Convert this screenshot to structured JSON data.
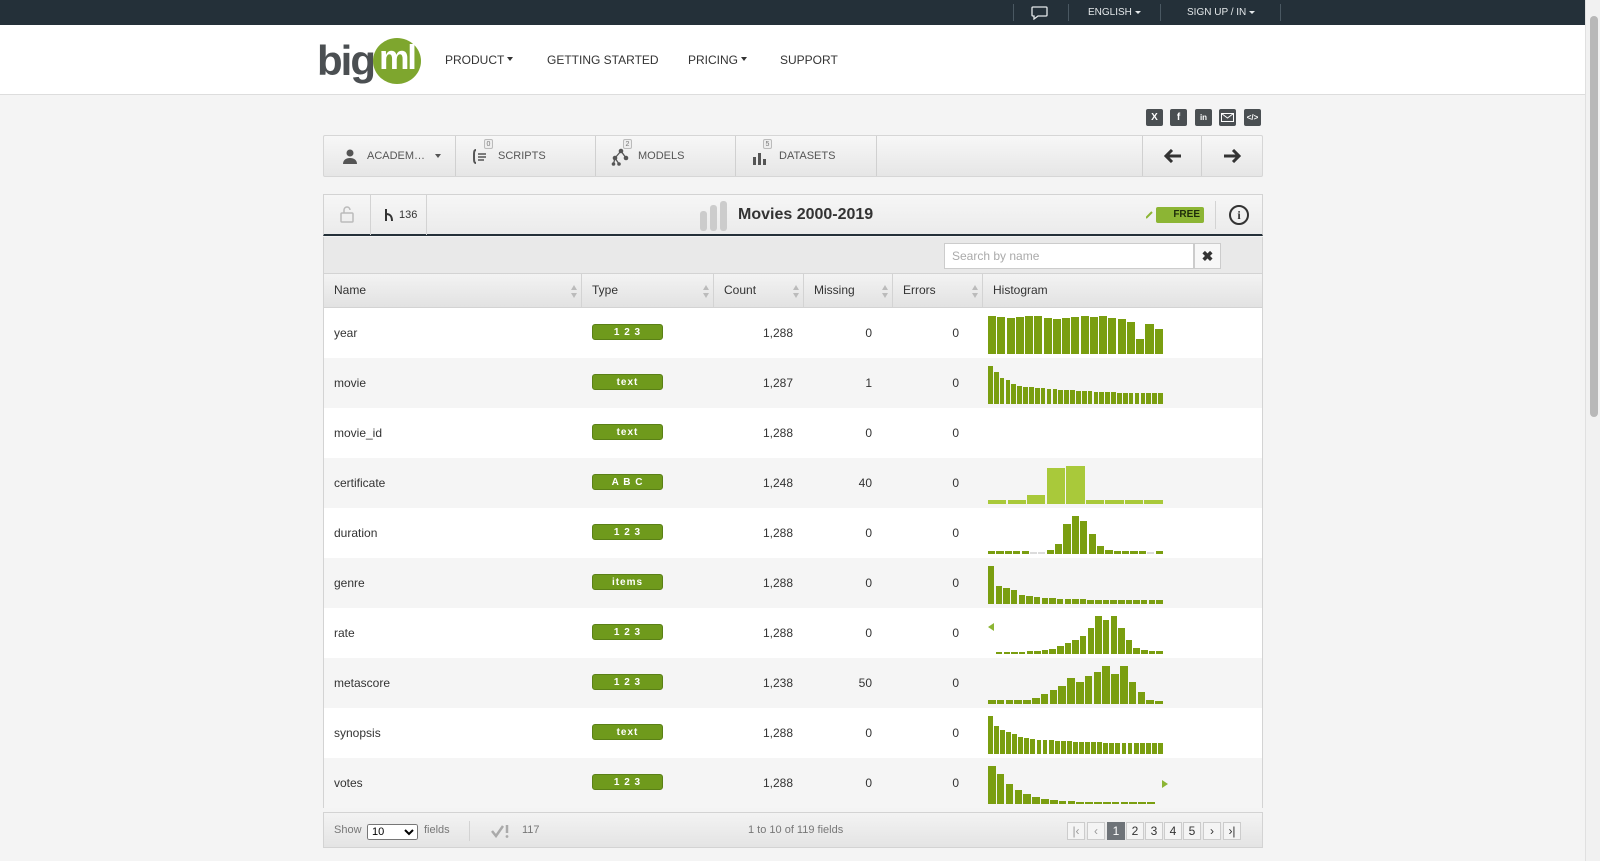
{
  "topbar": {
    "language": "ENGLISH",
    "signup": "SIGN UP / IN"
  },
  "brand": {
    "big": "big",
    "ml": "ml"
  },
  "nav": {
    "product": "PRODUCT",
    "getting_started": "GETTING STARTED",
    "pricing": "PRICING",
    "support": "SUPPORT"
  },
  "toolbar": {
    "account": "ACADEM…",
    "scripts": {
      "label": "SCRIPTS",
      "count": "0"
    },
    "models": {
      "label": "MODELS",
      "count": "2"
    },
    "datasets": {
      "label": "DATASETS",
      "count": "5"
    }
  },
  "dataset": {
    "title": "Movies 2000-2019",
    "clones": "136",
    "badge": "FREE"
  },
  "search": {
    "placeholder": "Search by name",
    "value": ""
  },
  "columns": {
    "name": "Name",
    "type": "Type",
    "count": "Count",
    "missing": "Missing",
    "errors": "Errors",
    "histogram": "Histogram"
  },
  "colors": {
    "accent": "#7ea62e",
    "bar": "#7a9e10",
    "bar_light": "#a9c93a",
    "missing_bar": "#dcdcdc",
    "topbar": "#243039"
  },
  "fields": [
    {
      "name": "year",
      "type": "1 2 3",
      "count": "1,288",
      "missing": "0",
      "errors": "0",
      "histogram": [
        36,
        35,
        34,
        35,
        36,
        36,
        34,
        33,
        34,
        35,
        36,
        35,
        36,
        34,
        33,
        30,
        14,
        28,
        24
      ]
    },
    {
      "name": "movie",
      "type": "text",
      "count": "1,287",
      "missing": "1",
      "errors": "0",
      "histogram": [
        38,
        32,
        26,
        24,
        20,
        18,
        17,
        17,
        16,
        16,
        15,
        15,
        14,
        14,
        14,
        13,
        13,
        13,
        12,
        12,
        12,
        12,
        11,
        11,
        11,
        11,
        11,
        11,
        11,
        11
      ]
    },
    {
      "name": "movie_id",
      "type": "text",
      "count": "1,288",
      "missing": "0",
      "errors": "0",
      "histogram": []
    },
    {
      "name": "certificate",
      "type": "A B C",
      "count": "1,248",
      "missing": "40",
      "errors": "0",
      "histogram": [
        4,
        4,
        9,
        36,
        38,
        4,
        4,
        4,
        4
      ]
    },
    {
      "name": "duration",
      "type": "1 2 3",
      "count": "1,288",
      "missing": "0",
      "errors": "0",
      "histogram": [
        3,
        3,
        3,
        3,
        3,
        1,
        1,
        4,
        10,
        30,
        38,
        33,
        20,
        8,
        4,
        3,
        3,
        3,
        3,
        1,
        3
      ]
    },
    {
      "name": "genre",
      "type": "items",
      "count": "1,288",
      "missing": "0",
      "errors": "0",
      "histogram": [
        38,
        18,
        16,
        14,
        9,
        8,
        7,
        6,
        6,
        5,
        5,
        5,
        5,
        4,
        4,
        4,
        4,
        4,
        4,
        4,
        4,
        4,
        4
      ]
    },
    {
      "name": "rate",
      "type": "1 2 3",
      "count": "1,288",
      "missing": "0",
      "errors": "0",
      "histogram": [
        2,
        2,
        2,
        2,
        3,
        3,
        4,
        5,
        8,
        11,
        14,
        18,
        26,
        38,
        34,
        38,
        26,
        14,
        6,
        4,
        3,
        3
      ]
    },
    {
      "name": "metascore",
      "type": "1 2 3",
      "count": "1,238",
      "missing": "50",
      "errors": "0",
      "histogram": [
        4,
        4,
        4,
        4,
        4,
        6,
        10,
        14,
        18,
        26,
        22,
        28,
        32,
        38,
        30,
        38,
        22,
        12,
        4,
        3
      ]
    },
    {
      "name": "synopsis",
      "type": "text",
      "count": "1,288",
      "missing": "0",
      "errors": "0",
      "histogram": [
        38,
        28,
        24,
        22,
        20,
        17,
        16,
        15,
        14,
        14,
        14,
        13,
        13,
        13,
        12,
        12,
        12,
        12,
        12,
        11,
        11,
        11,
        11,
        11,
        11,
        11,
        11,
        11,
        11
      ]
    },
    {
      "name": "votes",
      "type": "1 2 3",
      "count": "1,288",
      "missing": "0",
      "errors": "0",
      "histogram": [
        38,
        30,
        20,
        14,
        10,
        7,
        5,
        4,
        3,
        3,
        2,
        2,
        2,
        2,
        2,
        2,
        2,
        2,
        2
      ]
    }
  ],
  "footer": {
    "show": "Show",
    "show_value": "10",
    "fields_label": "fields",
    "valid": "117",
    "range": "1 to 10 of 119 fields",
    "pages": [
      "1",
      "2",
      "3",
      "4",
      "5"
    ]
  }
}
